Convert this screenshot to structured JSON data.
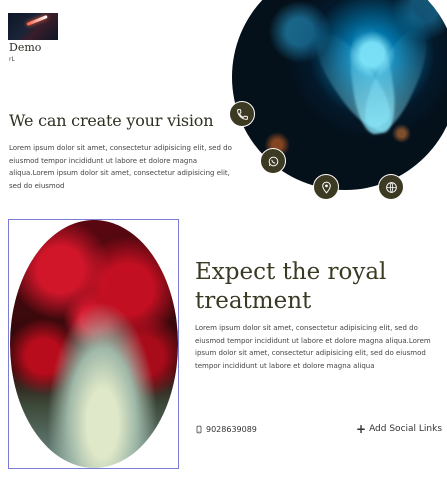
{
  "header": {
    "brand": "Demo",
    "brand_sub": "rL"
  },
  "hero": {
    "heading": "We can create your vision",
    "paragraph": "Lorem ipsum dolor sit amet, consectetur adipisicing elit, sed do eiusmod tempor incididunt ut labore et dolore magna aliqua.Lorem ipsum dolor sit amet, consectetur adipisicing elit, sed do eiusmod"
  },
  "contact_icons": [
    {
      "name": "phone-icon"
    },
    {
      "name": "whatsapp-icon"
    },
    {
      "name": "location-icon"
    },
    {
      "name": "globe-icon"
    }
  ],
  "feature": {
    "heading": "Expect the royal treatment",
    "paragraph": "Lorem ipsum dolor sit amet, consectetur adipisicing elit, sed do eiusmod tempor incididunt ut labore et dolore magna aliqua.Lorem ipsum dolor sit amet, consectetur adipisicing elit, sed do eiusmod tempor incididunt ut labore et dolore magna aliqua"
  },
  "footer": {
    "phone": "9028639089",
    "add_social_label": "Add Social Links"
  },
  "colors": {
    "accent": "#3d3a24",
    "selection_border": "#7b7bd8"
  }
}
